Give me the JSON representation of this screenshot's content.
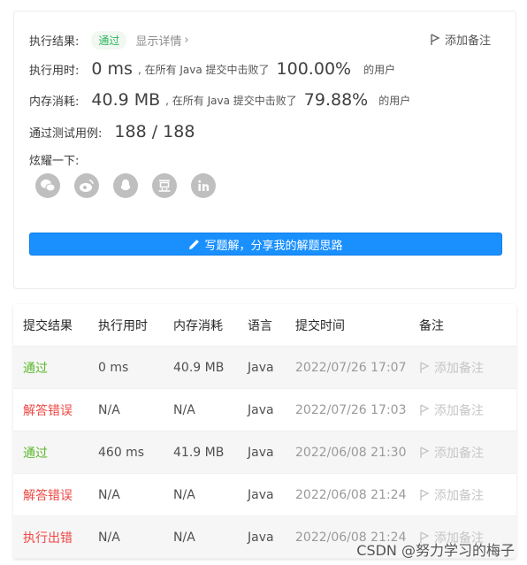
{
  "summary": {
    "result_label": "执行结果:",
    "result_value": "通过",
    "detail_link": "显示详情",
    "add_note": "添加备注",
    "runtime_label": "执行用时:",
    "runtime_value": "0 ms",
    "runtime_pre": ", 在所有 Java 提交中击败了",
    "runtime_percent": "100.00%",
    "runtime_post": "的用户",
    "memory_label": "内存消耗:",
    "memory_value": "40.9 MB",
    "memory_pre": ", 在所有 Java 提交中击败了",
    "memory_percent": "79.88%",
    "memory_post": "的用户",
    "tests_label": "通过测试用例:",
    "tests_value": "188 / 188",
    "share_label": "炫耀一下:",
    "share_icons": [
      "wechat-icon",
      "weibo-icon",
      "qq-icon",
      "douban-icon",
      "linkedin-icon"
    ],
    "write_solution": "写题解，分享我的解题思路"
  },
  "table": {
    "headers": [
      "提交结果",
      "执行用时",
      "内存消耗",
      "语言",
      "提交时间",
      "备注"
    ],
    "rows": [
      {
        "status": "通过",
        "ok": true,
        "time": "0 ms",
        "memory": "40.9 MB",
        "lang": "Java",
        "submitted": "2022/07/26 17:07",
        "note": "添加备注"
      },
      {
        "status": "解答错误",
        "ok": false,
        "time": "N/A",
        "memory": "N/A",
        "lang": "Java",
        "submitted": "2022/07/26 17:03",
        "note": "添加备注"
      },
      {
        "status": "通过",
        "ok": true,
        "time": "460 ms",
        "memory": "41.9 MB",
        "lang": "Java",
        "submitted": "2022/06/08 21:30",
        "note": "添加备注"
      },
      {
        "status": "解答错误",
        "ok": false,
        "time": "N/A",
        "memory": "N/A",
        "lang": "Java",
        "submitted": "2022/06/08 21:24",
        "note": "添加备注"
      },
      {
        "status": "执行出错",
        "ok": false,
        "time": "N/A",
        "memory": "N/A",
        "lang": "Java",
        "submitted": "2022/06/08 21:24",
        "note": "添加备注"
      }
    ]
  },
  "watermark": "CSDN @努力学习的梅子",
  "colors": {
    "accent": "#1a90ff",
    "success": "#5cb82a",
    "error": "#ef4743"
  }
}
